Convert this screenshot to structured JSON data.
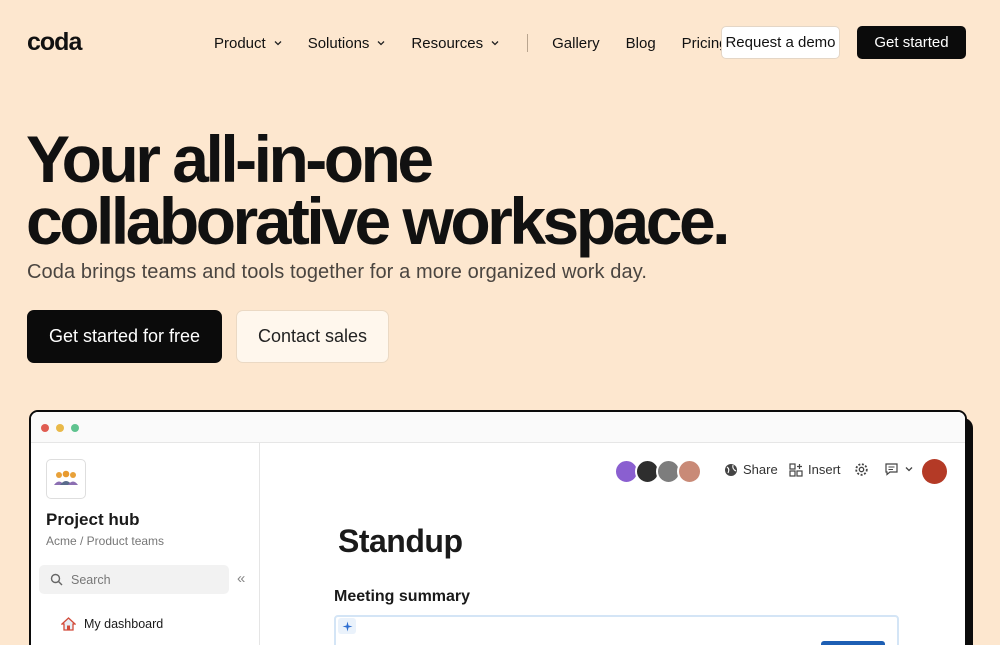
{
  "nav": {
    "logo": "coda",
    "items": [
      {
        "label": "Product",
        "dropdown": true
      },
      {
        "label": "Solutions",
        "dropdown": true
      },
      {
        "label": "Resources",
        "dropdown": true
      }
    ],
    "links": [
      "Gallery",
      "Blog",
      "Pricing"
    ],
    "demo_button": "Request a demo",
    "started_button": "Get started"
  },
  "hero": {
    "title_line1": "Your all-in-one",
    "title_line2": "collaborative workspace.",
    "subtitle": "Coda brings teams and tools together for a more organized work day.",
    "primary_cta": "Get started for free",
    "secondary_cta": "Contact sales"
  },
  "app": {
    "sidebar": {
      "hub_title": "Project hub",
      "hub_path": "Acme / Product teams",
      "search_placeholder": "Search",
      "collapse_glyph": "«",
      "items": [
        {
          "label": "My dashboard",
          "icon": "house-icon"
        }
      ]
    },
    "toolbar": {
      "share": "Share",
      "insert": "Insert"
    },
    "doc": {
      "title": "Standup",
      "section": "Meeting summary"
    }
  },
  "colors": {
    "background": "#fde7cf",
    "primary_button": "#0b0b0b",
    "window_dot_red": "#e05d52",
    "window_dot_yellow": "#e9b949",
    "window_dot_green": "#5fc38f",
    "ai_accent": "#1d5fb4"
  }
}
